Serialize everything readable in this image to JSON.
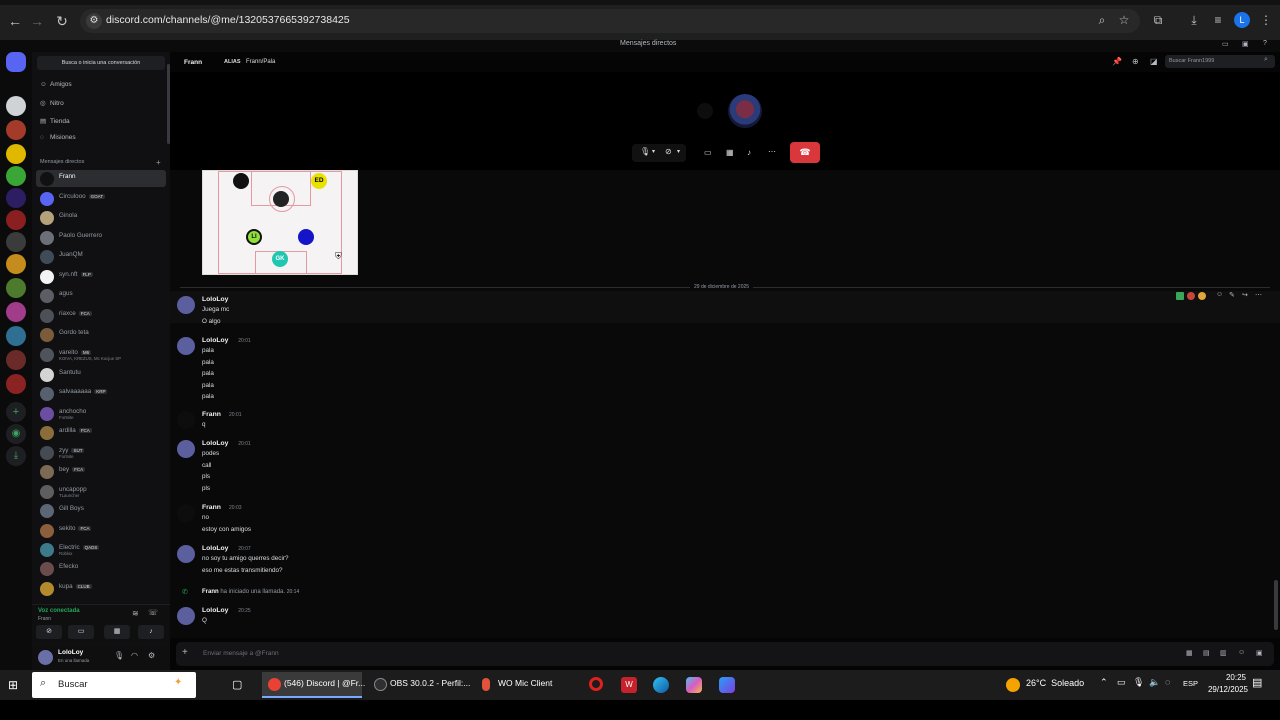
{
  "browser": {
    "url": "discord.com/channels/@me/1320537665392738425"
  },
  "window": {
    "title": "Mensajes directos"
  },
  "sidebar": {
    "search_label": "Busca o inicia una conversación",
    "nav": [
      {
        "label": "Amigos",
        "icon": "friends-icon"
      },
      {
        "label": "Nitro",
        "icon": "nitro-icon"
      },
      {
        "label": "Tienda",
        "icon": "shop-icon"
      },
      {
        "label": "Misiones",
        "icon": "quests-icon"
      }
    ],
    "dm_header": "Mensajes directos",
    "dms": [
      {
        "name": "Frann",
        "tag": "",
        "sub": "",
        "color": "#111111"
      },
      {
        "name": "Circulooo",
        "tag": "GOAT",
        "sub": "",
        "color": "#5865f2"
      },
      {
        "name": "Ginola",
        "tag": "",
        "sub": "",
        "color": "#b5a27a"
      },
      {
        "name": "Paolo Guerrero",
        "tag": "",
        "sub": "",
        "color": "#6d6f78"
      },
      {
        "name": "JuanQM",
        "tag": "",
        "sub": "",
        "color": "#3f4b57"
      },
      {
        "name": "syn.nft",
        "tag": "FLP",
        "sub": "",
        "color": "#f2f3f5"
      },
      {
        "name": "agus",
        "tag": "",
        "sub": "",
        "color": "#5c5e66"
      },
      {
        "name": "riaxce",
        "tag": "FCA",
        "sub": "",
        "color": "#4e5058"
      },
      {
        "name": "Gordo teta",
        "tag": "",
        "sub": "",
        "color": "#7a5c3a"
      },
      {
        "name": "vareito",
        "tag": "M6",
        "sub": "KOIVA, KREZUS, Mc Kocjue SP",
        "color": "#4f545c"
      },
      {
        "name": "Santutu",
        "tag": "",
        "sub": "",
        "color": "#d4d4d4"
      },
      {
        "name": "salvaaaaaa",
        "tag": "KRP",
        "sub": "",
        "color": "#57606e"
      },
      {
        "name": "anchocho",
        "tag": "",
        "sub": "Fortnite",
        "color": "#6b4ea1"
      },
      {
        "name": "ardilla",
        "tag": "FCA",
        "sub": "",
        "color": "#8a6d3b"
      },
      {
        "name": "zyy",
        "tag": "SUT",
        "sub": "Fortnite",
        "color": "#454a53"
      },
      {
        "name": "bey",
        "tag": "FCA",
        "sub": "",
        "color": "#7c6a55"
      },
      {
        "name": "uncapopp",
        "tag": "",
        "sub": "TLauncher",
        "color": "#5e5e5e"
      },
      {
        "name": "Gill Boys",
        "tag": "",
        "sub": "",
        "color": "#5d6674"
      },
      {
        "name": "sekito",
        "tag": "FCA",
        "sub": "",
        "color": "#8b5e3c"
      },
      {
        "name": "Electric",
        "tag": "QADS",
        "sub": "Roblox",
        "color": "#3d7a8a"
      },
      {
        "name": "Efecko",
        "tag": "",
        "sub": "",
        "color": "#6a4c4c"
      },
      {
        "name": "kupa",
        "tag": "CLUB",
        "sub": "",
        "color": "#b38b2d"
      }
    ],
    "voice": {
      "status": "Voz conectada",
      "channel": "Frann"
    },
    "user": {
      "name": "LoloLoy",
      "status": "En una llamada"
    }
  },
  "header": {
    "name": "Frann",
    "alias_label": "ALIAS",
    "alias": "Frann/Pala",
    "search_placeholder": "Buscar Frann1999"
  },
  "date_divider": "29 de diciembre de 2025",
  "messages": [
    {
      "author": "LoloLoy",
      "time": "",
      "lines": [
        "Juega mc",
        "O algo"
      ]
    },
    {
      "author": "LoloLoy",
      "time": "20:01",
      "lines": [
        "pala",
        "pala",
        "pala",
        "pala",
        "pala"
      ]
    },
    {
      "author": "Frann",
      "time": "20:01",
      "lines": [
        "q"
      ]
    },
    {
      "author": "LoloLoy",
      "time": "20:01",
      "lines": [
        "podes",
        "call",
        "pls",
        "pls"
      ]
    },
    {
      "author": "Frann",
      "time": "20:03",
      "lines": [
        "no",
        "estoy con amigos"
      ]
    },
    {
      "author": "LoloLoy",
      "time": "20:07",
      "lines": [
        "no soy tu amigo querres decir?",
        "eso me estas transmitiendo?"
      ]
    },
    {
      "author": "LoloLoy",
      "time": "20:25",
      "lines": [
        "Q"
      ]
    }
  ],
  "call_event": {
    "name": "Frann",
    "text": "ha iniciado una llamada.",
    "time": "20:14"
  },
  "image_labels": [
    "ED",
    "LI",
    "GK"
  ],
  "compose_placeholder": "Enviar mensaje a @Frann",
  "taskbar": {
    "search": "Buscar",
    "apps": [
      {
        "label": "(546) Discord | @Fr..."
      },
      {
        "label": "OBS 30.0.2 - Perfil:..."
      },
      {
        "label": "WO Mic Client"
      }
    ],
    "weather": "26°C  Soleado",
    "lang": "ESP",
    "time": "20:25",
    "date": "29/12/2025"
  }
}
